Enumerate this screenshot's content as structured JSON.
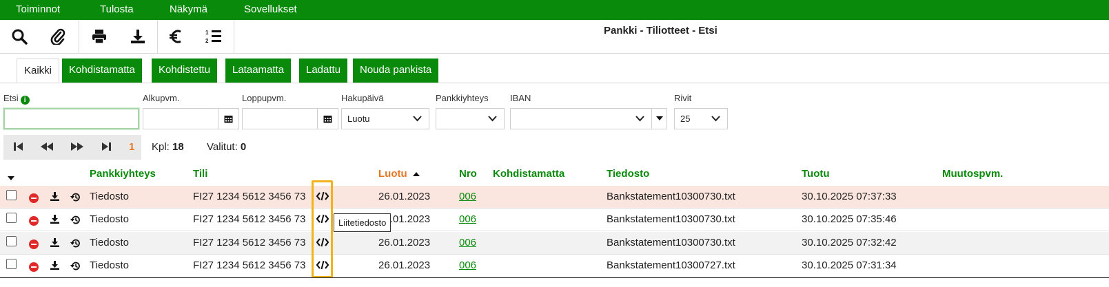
{
  "menu": [
    "Toiminnot",
    "Tulosta",
    "Näkymä",
    "Sovellukset"
  ],
  "toolbar": {
    "icons": [
      "search-icon",
      "attach-icon",
      "print-icon",
      "download-icon",
      "euro-icon",
      "numbered-list-icon"
    ],
    "title": "Pankki - Tiliotteet - Etsi"
  },
  "tabs": [
    "Kaikki",
    "Kohdistamatta",
    "Kohdistettu",
    "Lataamatta",
    "Ladattu",
    "Nouda pankista"
  ],
  "filters": {
    "etsi_label": "Etsi",
    "info_glyph": "i",
    "etsi_value": "",
    "alkupvm_label": "Alkupvm.",
    "alkupvm_value": "",
    "loppupvm_label": "Loppupvm.",
    "loppupvm_value": "",
    "hakupaiva_label": "Hakupäivä",
    "hakupaiva_value": "Luotu",
    "pankkiyhteys_label": "Pankkiyhteys",
    "pankkiyhteys_value": "",
    "iban_label": "IBAN",
    "iban_value": "",
    "rivit_label": "Rivit",
    "rivit_value": "25"
  },
  "pager": {
    "page": "1",
    "kpl_label": "Kpl:",
    "kpl_value": "18",
    "valitut_label": "Valitut:",
    "valitut_value": "0"
  },
  "table": {
    "headers": {
      "pankkiyhteys": "Pankkiyhteys",
      "tili": "Tili",
      "luotu": "Luotu",
      "nro": "Nro",
      "kohdistamatta": "Kohdistamatta",
      "tiedosto": "Tiedosto",
      "tuotu": "Tuotu",
      "muutospvm": "Muutospvm."
    },
    "rows": [
      {
        "pankkiyhteys": "Tiedosto",
        "tili": "FI27 1234 5612 3456 73",
        "luotu": "26.01.2023",
        "nro": "006",
        "kohdistamatta": "",
        "tiedosto": "Bankstatement10300730.txt",
        "tuotu": "30.10.2025 07:37:33",
        "muutospvm": ""
      },
      {
        "pankkiyhteys": "Tiedosto",
        "tili": "FI27 1234 5612 3456 73",
        "luotu": "26.01.2023",
        "nro": "006",
        "kohdistamatta": "",
        "tiedosto": "Bankstatement10300730.txt",
        "tuotu": "30.10.2025 07:35:46",
        "muutospvm": ""
      },
      {
        "pankkiyhteys": "Tiedosto",
        "tili": "FI27 1234 5612 3456 73",
        "luotu": "26.01.2023",
        "nro": "006",
        "kohdistamatta": "",
        "tiedosto": "Bankstatement10300730.txt",
        "tuotu": "30.10.2025 07:32:42",
        "muutospvm": ""
      },
      {
        "pankkiyhteys": "Tiedosto",
        "tili": "FI27 1234 5612 3456 73",
        "luotu": "26.01.2023",
        "nro": "006",
        "kohdistamatta": "",
        "tiedosto": "Bankstatement10300727.txt",
        "tuotu": "30.10.2025 07:31:34",
        "muutospvm": ""
      }
    ]
  },
  "tooltip": "Liitetiedosto",
  "colors": {
    "brand_green": "#0a8a0a",
    "sort_orange": "#e87722",
    "highlight": "#f2b21b",
    "row_highlight": "#fbe6df"
  }
}
